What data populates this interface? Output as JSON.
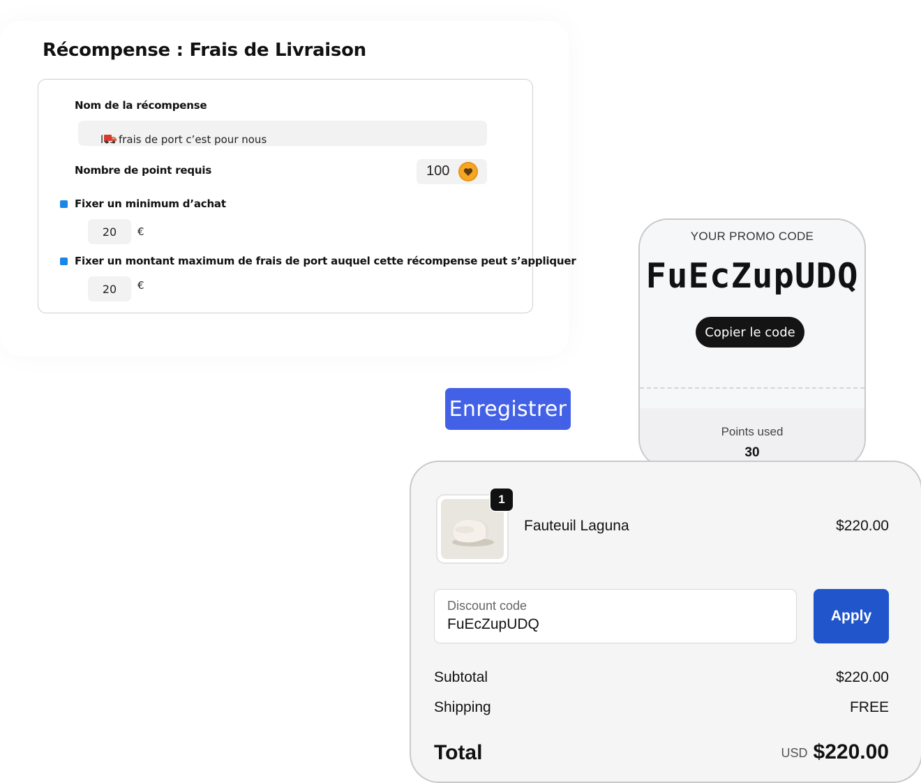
{
  "reward": {
    "title": "Récompense : Frais de Livraison",
    "name_label": "Nom de la récompense",
    "name_value": "les frais de port c’est pour nous",
    "points_label": "Nombre de point requis",
    "points_value": "100",
    "min_purchase_label": "Fixer un minimum d’achat",
    "min_purchase_value": "20",
    "min_purchase_currency": "€",
    "max_shipping_label": "Fixer un montant maximum de frais de port auquel cette récompense peut s’appliquer",
    "max_shipping_value": "20",
    "max_shipping_currency": "€",
    "save_label": "Enregistrer",
    "accent_color": "#4361e6",
    "checkbox_color": "#1a87e6",
    "icons": [
      "truck-icon",
      "heart-coin-icon"
    ]
  },
  "promo": {
    "label": "YOUR PROMO CODE",
    "code": "FuEcZupUDQ",
    "copy_label": "Copier le code",
    "points_used_label": "Points used",
    "points_used_value": "30"
  },
  "checkout": {
    "item": {
      "quantity": "1",
      "name": "Fauteuil Laguna",
      "price": "$220.00"
    },
    "discount": {
      "placeholder": "Discount code",
      "value": "FuEcZupUDQ",
      "apply_label": "Apply"
    },
    "subtotal_label": "Subtotal",
    "subtotal_value": "$220.00",
    "shipping_label": "Shipping",
    "shipping_value": "FREE",
    "total_label": "Total",
    "total_currency": "USD",
    "total_value": "$220.00",
    "apply_color": "#2055cc"
  }
}
